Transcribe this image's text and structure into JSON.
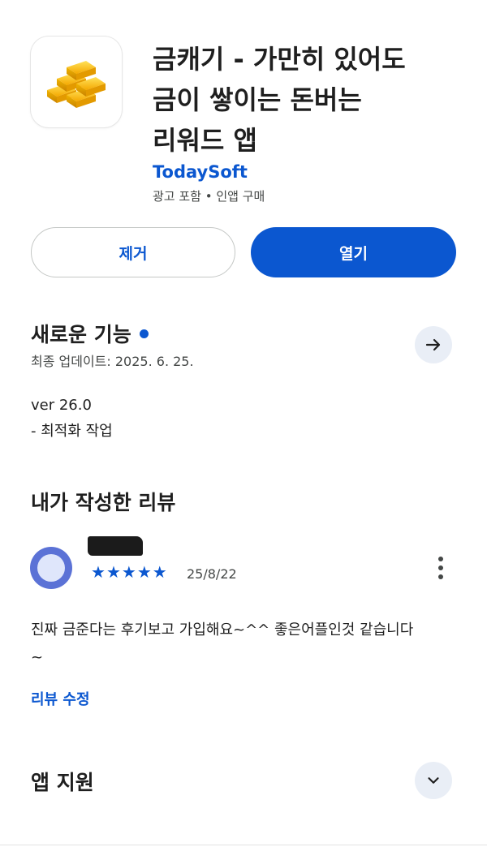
{
  "app": {
    "title": "금캐기 - 가만히 있어도\n금이 쌓이는 돈버는\n리워드 앱",
    "developer": "TodaySoft",
    "meta": "광고 포함 • 인앱 구매",
    "icon": "gold-bars-icon"
  },
  "actions": {
    "uninstall_label": "제거",
    "open_label": "열기"
  },
  "whats_new": {
    "title": "새로운 기능",
    "updated": "최종 업데이트: 2025. 6. 25.",
    "version": "ver 26.0",
    "note": "- 최적화 작업"
  },
  "my_review": {
    "title": "내가 작성한 리뷰",
    "rating": 5,
    "stars": [
      "★",
      "★",
      "★",
      "★",
      "★"
    ],
    "date": "25/8/22",
    "text": "진짜 금준다는 후기보고 가입해요~^^ 좋은어플인것 같습니다~",
    "edit_label": "리뷰 수정"
  },
  "app_support": {
    "title": "앱 지원"
  },
  "colors": {
    "accent": "#0b57d0",
    "text": "#1f1f1f",
    "secondary_text": "#444746",
    "chip_bg": "#e9eef6"
  }
}
